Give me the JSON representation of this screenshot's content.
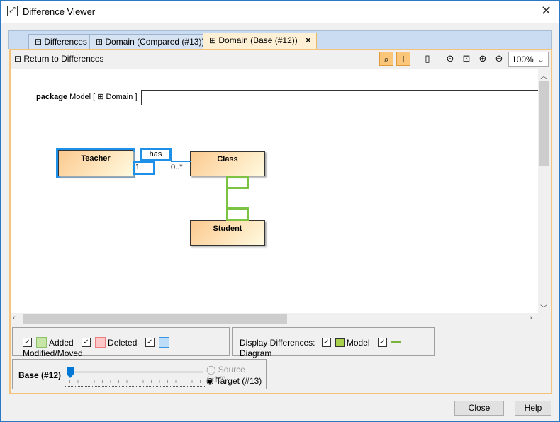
{
  "window": {
    "title": "Difference Viewer",
    "close": "✕"
  },
  "tabs": [
    {
      "label": "Differences"
    },
    {
      "label": "Domain (Compared (#13))"
    },
    {
      "label": "Domain (Base (#12))",
      "close": "✕"
    }
  ],
  "toolbar": {
    "return_label": "Return to Differences",
    "zoom": "100%"
  },
  "diagram": {
    "frame_kind": "package",
    "frame_name": "Model [",
    "frame_diagram": "Domain ]",
    "classes": [
      "Teacher",
      "Class",
      "Student"
    ],
    "association": {
      "name": "has",
      "mult_source": "1",
      "mult_target": "0..*"
    }
  },
  "legend": {
    "added": "Added",
    "deleted": "Deleted",
    "modified": "Modified/Moved",
    "colors": {
      "added": "#c6e5a6",
      "deleted": "#ffc8c8",
      "modified": "#bcdcf8"
    }
  },
  "display": {
    "label": "Display Differences:",
    "model": "Model",
    "diagram": "Diagram"
  },
  "slider": {
    "label": "Base (#12)",
    "source": "Source (#12)",
    "target": "Target (#13)",
    "value": 0
  },
  "buttons": {
    "close": "Close",
    "help": "Help"
  }
}
